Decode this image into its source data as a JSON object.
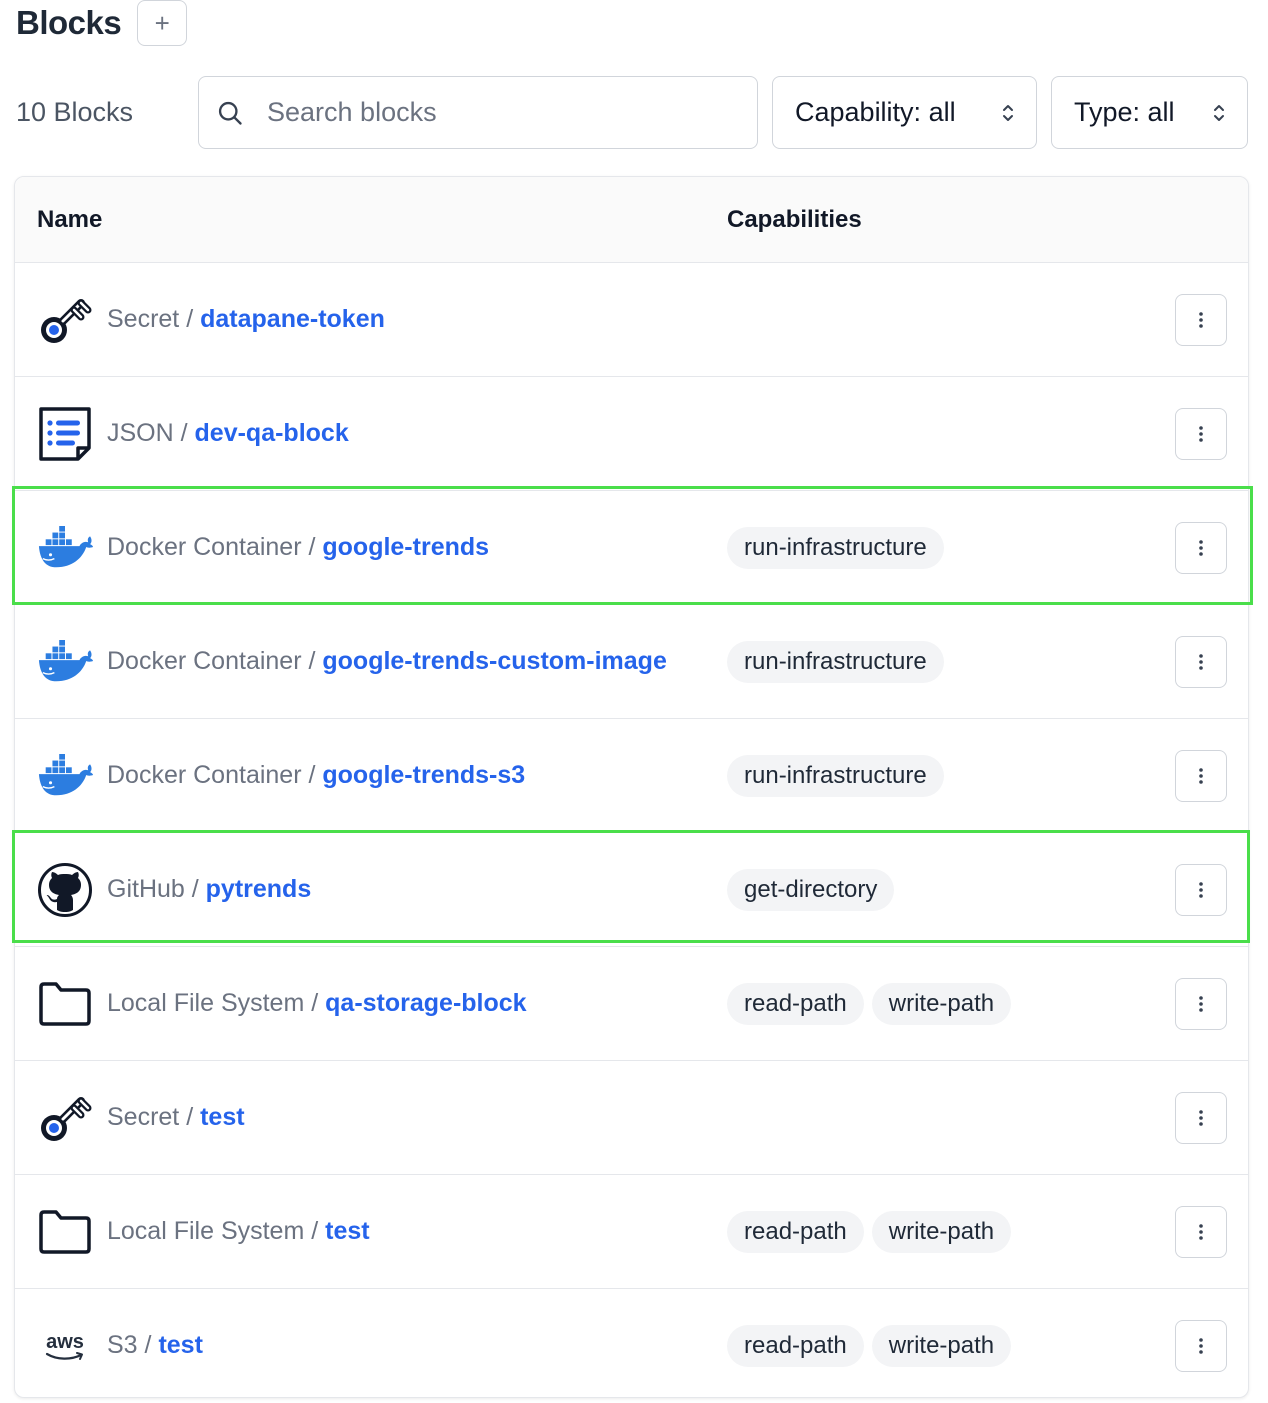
{
  "header": {
    "title": "Blocks",
    "add_label": "+"
  },
  "filters": {
    "count_label": "10 Blocks",
    "search_placeholder": "Search blocks",
    "search_value": "",
    "capability_label": "Capability: all",
    "type_label": "Type: all"
  },
  "table": {
    "columns": {
      "name": "Name",
      "capabilities": "Capabilities"
    },
    "rows": [
      {
        "type": "Secret",
        "name": "datapane-token",
        "icon": "key-icon",
        "capabilities": [],
        "highlighted": false
      },
      {
        "type": "JSON",
        "name": "dev-qa-block",
        "icon": "json-list-icon",
        "capabilities": [],
        "highlighted": false
      },
      {
        "type": "Docker Container",
        "name": "google-trends",
        "icon": "docker-icon",
        "capabilities": [
          "run-infrastructure"
        ],
        "highlighted": true
      },
      {
        "type": "Docker Container",
        "name": "google-trends-custom-image",
        "icon": "docker-icon",
        "capabilities": [
          "run-infrastructure"
        ],
        "highlighted": false
      },
      {
        "type": "Docker Container",
        "name": "google-trends-s3",
        "icon": "docker-icon",
        "capabilities": [
          "run-infrastructure"
        ],
        "highlighted": false
      },
      {
        "type": "GitHub",
        "name": "pytrends",
        "icon": "github-icon",
        "capabilities": [
          "get-directory"
        ],
        "highlighted": true
      },
      {
        "type": "Local File System",
        "name": "qa-storage-block",
        "icon": "folder-icon",
        "capabilities": [
          "read-path",
          "write-path"
        ],
        "highlighted": false
      },
      {
        "type": "Secret",
        "name": "test",
        "icon": "key-icon",
        "capabilities": [],
        "highlighted": false
      },
      {
        "type": "Local File System",
        "name": "test",
        "icon": "folder-icon",
        "capabilities": [
          "read-path",
          "write-path"
        ],
        "highlighted": false
      },
      {
        "type": "S3",
        "name": "test",
        "icon": "aws-icon",
        "icon_text": "aws",
        "capabilities": [
          "read-path",
          "write-path"
        ],
        "highlighted": false
      }
    ]
  },
  "colors": {
    "link": "#2563eb",
    "highlight": "#4ade4a",
    "docker_blue": "#2c7de0",
    "badge_bg": "#f3f4f6"
  }
}
